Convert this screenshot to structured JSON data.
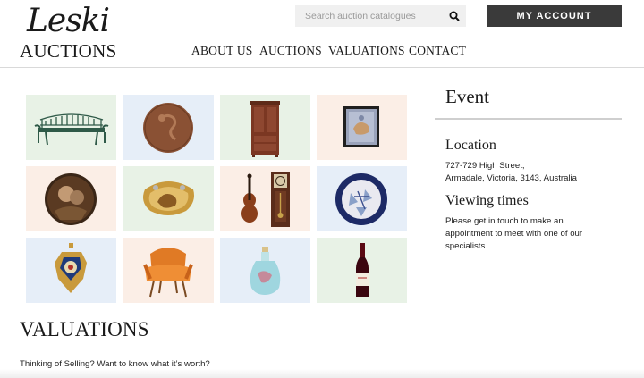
{
  "brand": {
    "script": "Leski",
    "word": "AUCTIONS"
  },
  "search": {
    "placeholder": "Search auction catalogues",
    "value": ""
  },
  "account": {
    "label": "MY ACCOUNT"
  },
  "nav": [
    "ABOUT US",
    "AUCTIONS",
    "VALUATIONS",
    "CONTACT"
  ],
  "gallery": {
    "tiles": [
      {
        "name": "garden-bench",
        "bg": "#e8f2e6"
      },
      {
        "name": "bronze-medal",
        "bg": "#e6eef8"
      },
      {
        "name": "wardrobe",
        "bg": "#e8f2e6"
      },
      {
        "name": "stamp",
        "bg": "#fbeee6"
      },
      {
        "name": "oval-portrait",
        "bg": "#fbeee6"
      },
      {
        "name": "gold-brooch",
        "bg": "#e8f2e6"
      },
      {
        "name": "violin-and-clock",
        "bg": "#fbeee6"
      },
      {
        "name": "decorated-plate",
        "bg": "#e6eef8"
      },
      {
        "name": "medal-pendant",
        "bg": "#e6eef8"
      },
      {
        "name": "orange-armchair",
        "bg": "#fbeee6"
      },
      {
        "name": "glass-decanter",
        "bg": "#e6eef8"
      },
      {
        "name": "wine-bottle",
        "bg": "#e8f2e6"
      }
    ]
  },
  "event": {
    "title": "Event",
    "location_heading": "Location",
    "address_line1": "727-729 High Street,",
    "address_line2": "Armadale, Victoria, 3143, Australia",
    "viewing_heading": "Viewing times",
    "viewing_line1": "Please get in touch to make an",
    "viewing_line2": "appointment to meet with one of our",
    "viewing_line3": "specialists."
  },
  "valuations": {
    "title": "VALUATIONS",
    "text": "Thinking of Selling?  Want to know what it’s worth?"
  }
}
